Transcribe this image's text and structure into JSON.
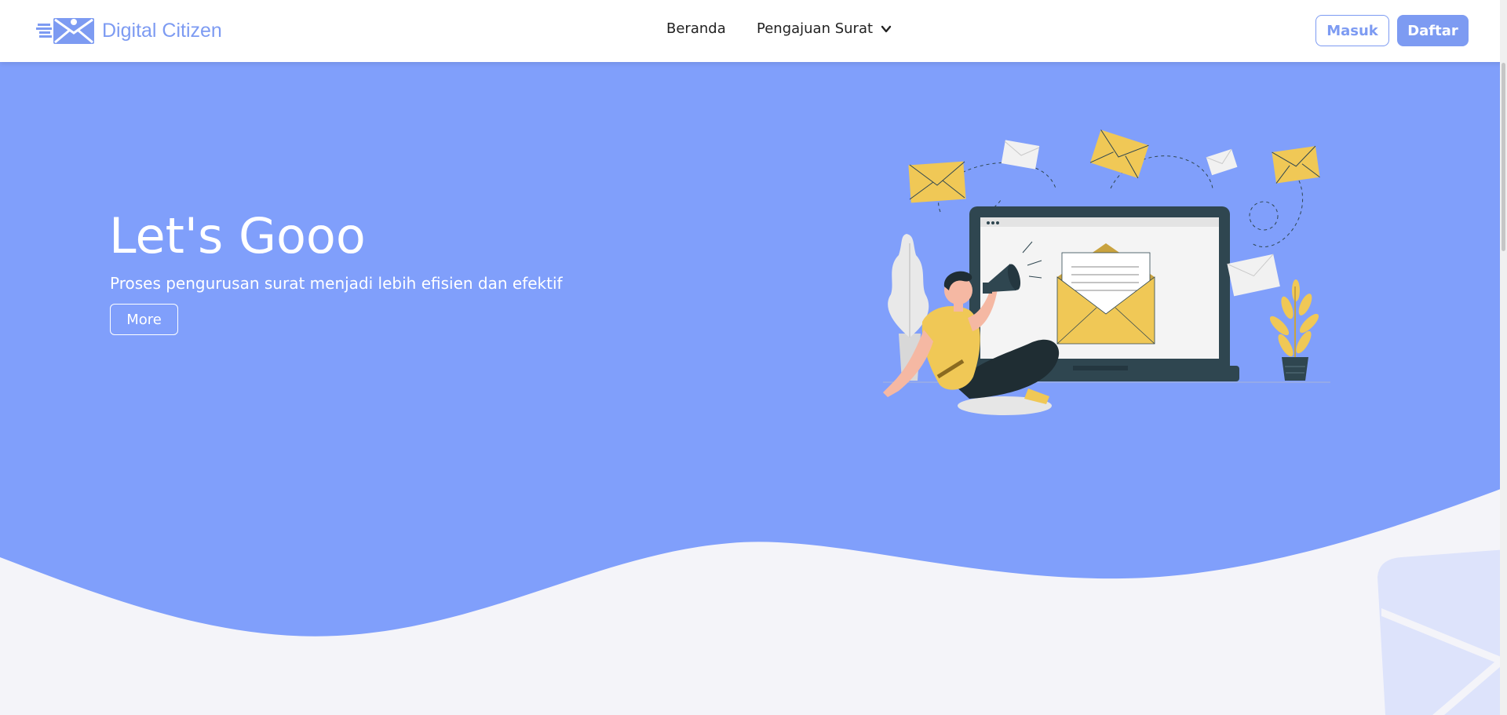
{
  "brand": {
    "name": "Digital Citizen",
    "logo_icon": "envelope-logo-icon",
    "color": "#7d9bf2"
  },
  "nav": {
    "home": "Beranda",
    "submission": "Pengajuan Surat",
    "submission_icon": "chevron-down-icon"
  },
  "auth": {
    "login": "Masuk",
    "register": "Daftar"
  },
  "hero": {
    "title": "Let's Gooo",
    "subtitle": "Proses pengurusan surat menjadi lebih efisien dan efektif",
    "more": "More",
    "illustration": "man-with-megaphone-laptop-envelopes-illustration"
  },
  "colors": {
    "hero_bg": "#809ffb",
    "page_bg": "#f4f4f9",
    "accent_yellow": "#f0c856",
    "dark": "#2f4650"
  }
}
